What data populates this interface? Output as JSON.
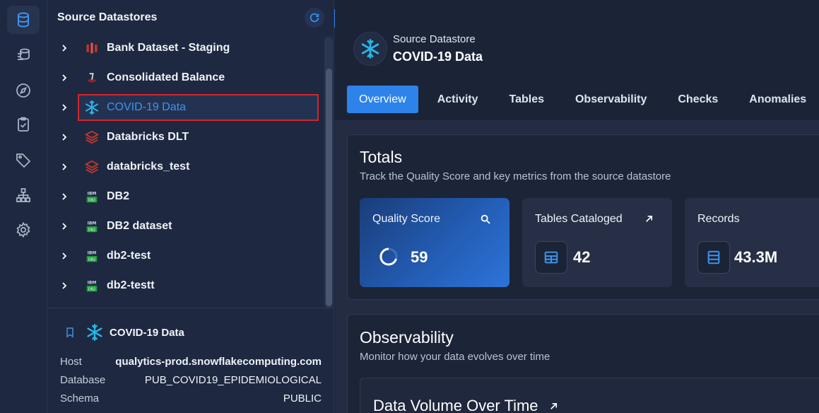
{
  "rail": {
    "items": [
      "database-icon",
      "layers-icon",
      "compass-icon",
      "clipboard-check-icon",
      "tag-icon",
      "hierarchy-icon",
      "settings-icon"
    ]
  },
  "tree": {
    "title": "Source Datastores",
    "items": [
      {
        "label": "Bank Dataset - Staging",
        "icon": "redshift-icon"
      },
      {
        "label": "Consolidated Balance",
        "icon": "db-icon"
      },
      {
        "label": "COVID-19 Data",
        "icon": "snowflake-icon",
        "selected": true
      },
      {
        "label": "Databricks DLT",
        "icon": "databricks-icon"
      },
      {
        "label": "databricks_test",
        "icon": "databricks-icon"
      },
      {
        "label": "DB2",
        "icon": "ibm-db2-icon"
      },
      {
        "label": "DB2 dataset",
        "icon": "ibm-db2-icon"
      },
      {
        "label": "db2-test",
        "icon": "ibm-db2-icon"
      },
      {
        "label": "db2-testt",
        "icon": "ibm-db2-icon"
      }
    ]
  },
  "detail": {
    "name": "COVID-19 Data",
    "rows": [
      {
        "key": "Host",
        "value": "qualytics-prod.snowflakecomputing.com"
      },
      {
        "key": "Database",
        "value": "PUB_COVID19_EPIDEMIOLOGICAL"
      },
      {
        "key": "Schema",
        "value": "PUBLIC"
      }
    ]
  },
  "header": {
    "kicker": "Source Datastore",
    "title": "COVID-19 Data"
  },
  "tabs": [
    "Overview",
    "Activity",
    "Tables",
    "Observability",
    "Checks",
    "Anomalies"
  ],
  "totals": {
    "title": "Totals",
    "subtitle": "Track the Quality Score and key metrics from the source datastore",
    "quality_score": {
      "label": "Quality Score",
      "value": "59"
    },
    "tables": {
      "label": "Tables Cataloged",
      "value": "42"
    },
    "records": {
      "label": "Records",
      "value": "43.3M"
    }
  },
  "observability": {
    "title": "Observability",
    "subtitle": "Monitor how your data evolves over time",
    "volume_title": "Data Volume Over Time"
  },
  "colors": {
    "accent": "#2d83ea",
    "selected_outline": "#d4252c"
  }
}
